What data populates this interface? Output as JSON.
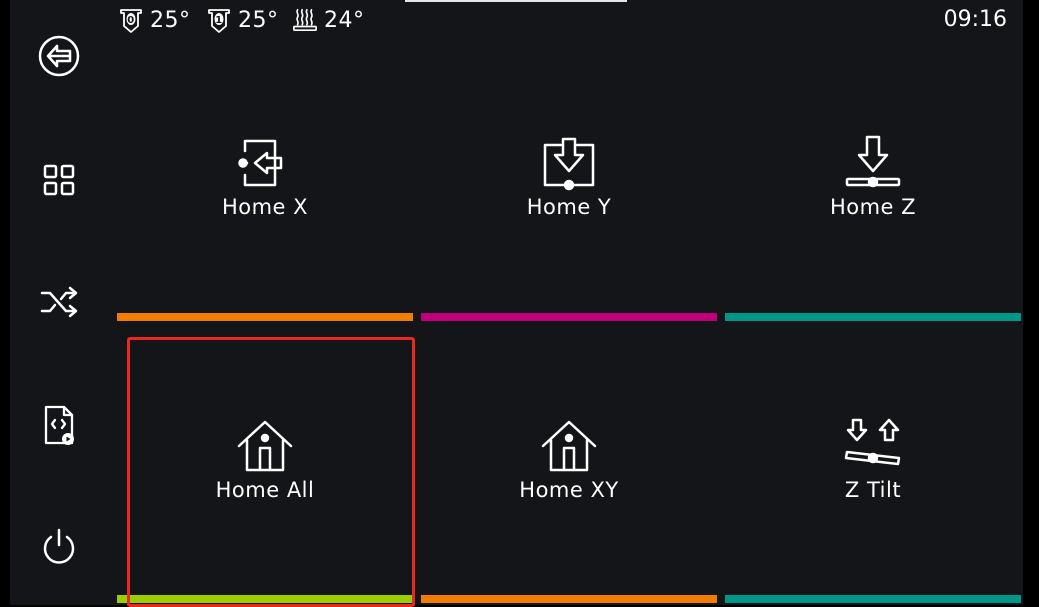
{
  "status": {
    "extruder0_temp": "25°",
    "extruder1_temp": "25°",
    "bed_temp": "24°",
    "time": "09:16"
  },
  "sidebar": {
    "items": [
      {
        "icon": "back-arrow-icon"
      },
      {
        "icon": "grid-menu-icon"
      },
      {
        "icon": "shuffle-icon"
      },
      {
        "icon": "gcode-file-icon"
      },
      {
        "icon": "power-icon"
      }
    ]
  },
  "tiles": [
    {
      "label": "Home X",
      "icon": "home-x-icon",
      "color": "#f07d00"
    },
    {
      "label": "Home Y",
      "icon": "home-y-icon",
      "color": "#c0007a"
    },
    {
      "label": "Home Z",
      "icon": "home-z-icon",
      "color": "#009688"
    },
    {
      "label": "Home All",
      "icon": "home-all-icon",
      "color": "#9ccd00"
    },
    {
      "label": "Home XY",
      "icon": "home-xy-icon",
      "color": "#f07d00"
    },
    {
      "label": "Z Tilt",
      "icon": "z-tilt-icon",
      "color": "#009688"
    }
  ],
  "highlight": {
    "color": "#e8291f"
  }
}
